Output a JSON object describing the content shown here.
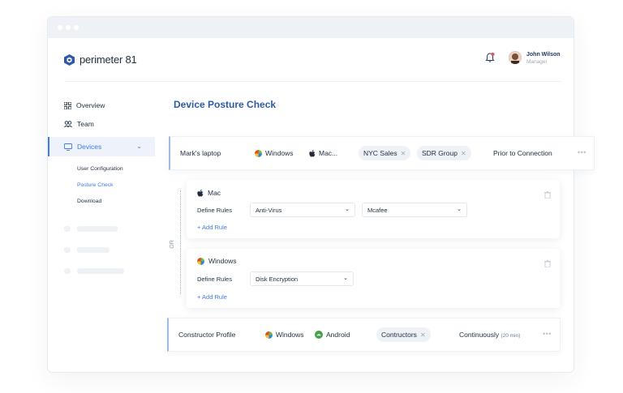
{
  "app": {
    "brand": "perimeter 81"
  },
  "user": {
    "name": "John Wilson",
    "role": "Manager"
  },
  "sidebar": {
    "items": [
      {
        "label": "Overview",
        "icon": "grid-icon"
      },
      {
        "label": "Team",
        "icon": "team-icon"
      },
      {
        "label": "Devices",
        "icon": "monitor-icon"
      }
    ],
    "sub_items": [
      {
        "label": "User Configuration"
      },
      {
        "label": "Posture Check"
      },
      {
        "label": "Download"
      }
    ]
  },
  "page": {
    "title": "Device Posture Check"
  },
  "rows": [
    {
      "name": "Mark's laptop",
      "os1": "Windows",
      "os2": "Mac...",
      "chips": [
        "NYC Sales",
        "SDR Group"
      ],
      "timing": "Prior to Connection",
      "more": "•••"
    },
    {
      "name": "Constructor Profile",
      "os1": "Windows",
      "os2": "Android",
      "chips": [
        "Contructors"
      ],
      "timing": "Continuously",
      "timing_detail": "(20 min)",
      "more": "•••"
    }
  ],
  "cards": [
    {
      "os": "Mac",
      "label": "Define Rules",
      "select1": "Anti-Virus",
      "select2": "Mcafee",
      "add": "+ Add Rule"
    },
    {
      "os": "Windows",
      "label": "Define Rules",
      "select1": "Disk Encryption",
      "add": "+ Add Rule"
    }
  ],
  "or_label": "OR",
  "colors": {
    "accent": "#3f7de0",
    "title": "#2d5aa8"
  }
}
